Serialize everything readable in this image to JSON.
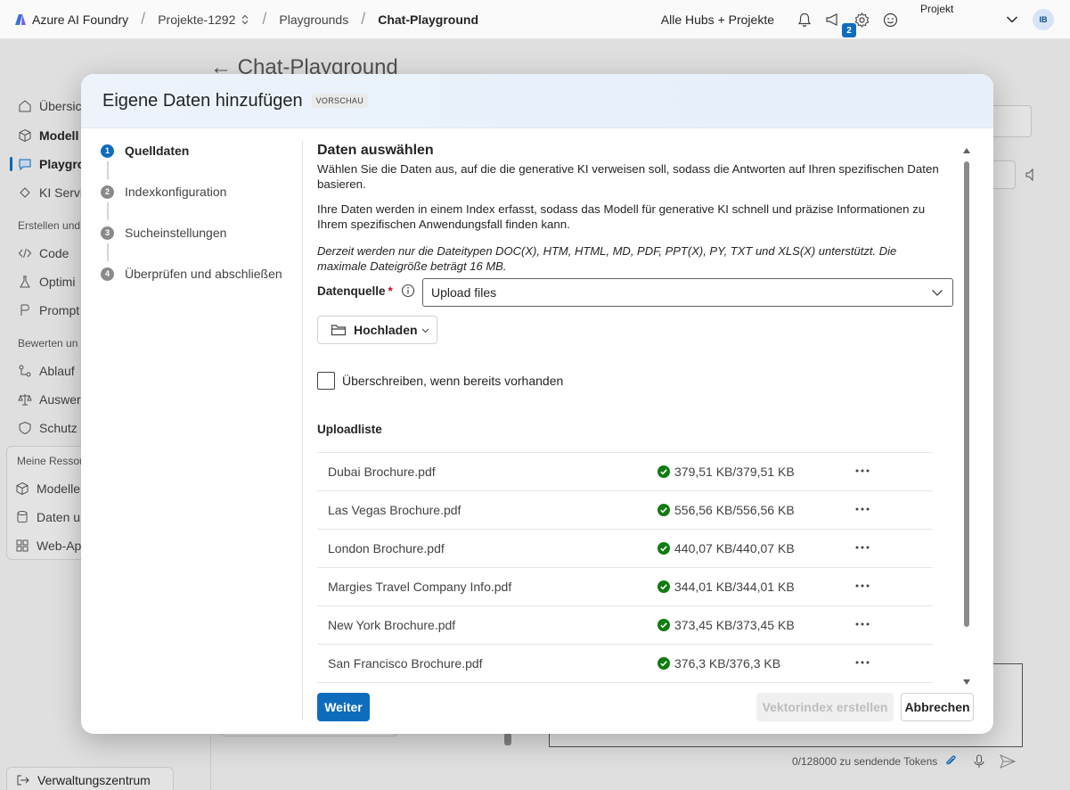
{
  "topbar": {
    "brand": "Azure AI Foundry",
    "breadcrumbs": [
      "Projekte-1292",
      "Playgrounds",
      "Chat-Playground"
    ],
    "hubs_label": "Alle Hubs + Projekte",
    "notification_count": "2",
    "project_label": "Projekt",
    "avatar_initials": "IB"
  },
  "background": {
    "page_title": "Chat-Playground",
    "sidebar_items": [
      "Übersic",
      "Modell",
      "Playgro",
      "KI Servi"
    ],
    "sidebar_head_1": "Erstellen und",
    "sidebar_items_2": [
      "Code",
      "Optimi",
      "Prompt"
    ],
    "sidebar_head_2": "Bewerten un",
    "sidebar_items_3": [
      "Ablauf",
      "Auswer",
      "Schutz"
    ],
    "sidebar_head_3": "Meine Ressou",
    "sidebar_items_4": [
      "Modelle",
      "Daten u",
      "Web-Ap"
    ],
    "admin_center": "Verwaltungszentrum",
    "tokens_label": "0/128000 zu sendende Tokens"
  },
  "dialog": {
    "title": "Eigene Daten hinzufügen",
    "badge": "VORSCHAU",
    "steps": [
      {
        "num": "1",
        "label": "Quelldaten",
        "active": true
      },
      {
        "num": "2",
        "label": "Indexkonfiguration",
        "active": false
      },
      {
        "num": "3",
        "label": "Sucheinstellungen",
        "active": false
      },
      {
        "num": "4",
        "label": "Überprüfen und abschließen",
        "active": false
      }
    ],
    "section_title": "Daten auswählen",
    "para1": "Wählen Sie die Daten aus, auf die die generative KI verweisen soll, sodass die Antworten auf Ihren spezifischen Daten basieren.",
    "para2": "Ihre Daten werden in einem Index erfasst, sodass das Modell für generative KI schnell und präzise Informationen zu Ihrem spezifischen Anwendungsfall finden kann.",
    "para3": "Derzeit werden nur die Dateitypen DOC(X), HTM, HTML, MD, PDF, PPT(X), PY, TXT und XLS(X) unterstützt. Die maximale Dateigröße beträgt 16 MB.",
    "datasource_label": "Datenquelle",
    "required_mark": "*",
    "datasource_value": "Upload files",
    "upload_button": "Hochladen",
    "overwrite_label": "Überschreiben, wenn bereits vorhanden",
    "upload_list_title": "Uploadliste",
    "files": [
      {
        "name": "Dubai Brochure.pdf",
        "size": "379,51 KB/379,51 KB"
      },
      {
        "name": "Las Vegas Brochure.pdf",
        "size": "556,56 KB/556,56 KB"
      },
      {
        "name": "London Brochure.pdf",
        "size": "440,07 KB/440,07 KB"
      },
      {
        "name": "Margies Travel Company Info.pdf",
        "size": "344,01 KB/344,01 KB"
      },
      {
        "name": "New York Brochure.pdf",
        "size": "373,45 KB/373,45 KB"
      },
      {
        "name": "San Francisco Brochure.pdf",
        "size": "376,3 KB/376,3 KB"
      }
    ],
    "next_button": "Weiter",
    "create_index_button": "Vektorindex erstellen",
    "cancel_button": "Abbrechen"
  },
  "colors": {
    "accent": "#0f6cbd",
    "success": "#107c10",
    "required": "#c50f1f"
  }
}
